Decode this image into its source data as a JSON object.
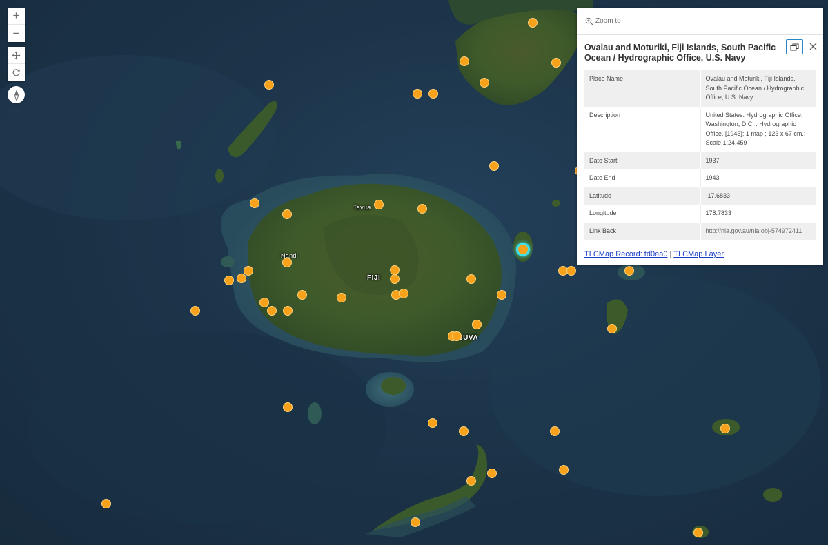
{
  "map": {
    "labels": {
      "tavua": "Tavua",
      "nandi": "Nandi",
      "fiji": "FIJI",
      "suva": "SUVA"
    },
    "marker_color": "#f7a21a",
    "selected_color": "#3fe0e8"
  },
  "controls": {
    "zoom_in": "+",
    "zoom_out": "−"
  },
  "popup": {
    "zoom_to_label": "Zoom to",
    "title": "Ovalau and Moturiki, Fiji Islands, South Pacific Ocean / Hydrographic Office, U.S. Navy",
    "rows": [
      {
        "key": "Place Name",
        "value": "Ovalau and Moturiki, Fiji Islands, South Pacific Ocean / Hydrographic Office, U.S. Navy"
      },
      {
        "key": "Description",
        "value": "United States. Hydrographic Office; Washington, D.C. : Hydrographic Office, [1943]; 1 map ; 123 x 67 cm.; Scale 1:24,459"
      },
      {
        "key": "Date Start",
        "value": "1937"
      },
      {
        "key": "Date End",
        "value": "1943"
      },
      {
        "key": "Latitude",
        "value": "-17.6833"
      },
      {
        "key": "Longitude",
        "value": "178.7833"
      },
      {
        "key": "Link Back",
        "value": "http://nla.gov.au/nla.obj-574972411"
      }
    ],
    "footer_record": "TLCMap Record: td0ea0",
    "footer_sep": "|",
    "footer_layer": "TLCMap Layer"
  }
}
